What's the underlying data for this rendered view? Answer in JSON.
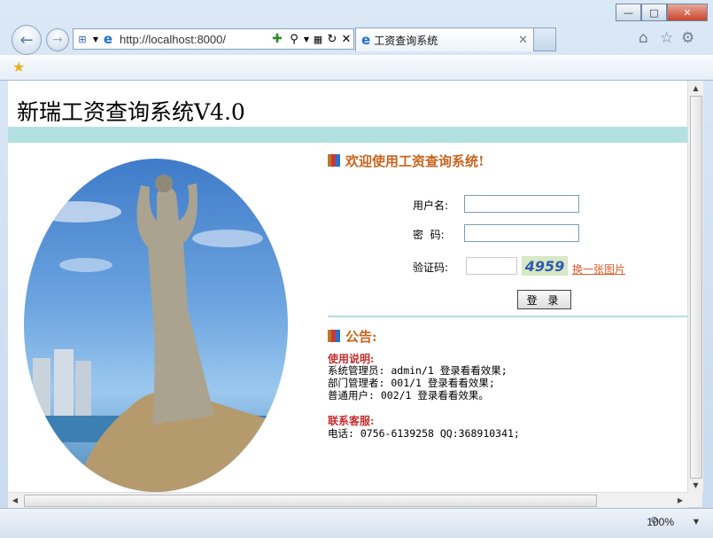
{
  "browser": {
    "url": "http://localhost:8000/",
    "tab_title": "工资查询系统",
    "zoom": "100%"
  },
  "page": {
    "title": "新瑞工资查询系统V4.0",
    "welcome": "欢迎使用工资查询系统!",
    "login": {
      "username_label": "用户名:",
      "password_label": "密  码:",
      "captcha_label": "验证码:",
      "captcha_code": "4959",
      "captcha_refresh": "换一张图片",
      "submit": "登 录"
    },
    "notice": {
      "title": "公告:",
      "usage_title": "使用说明:",
      "usage_lines": [
        "系统管理员: admin/1 登录看看效果;",
        "部门管理者: 001/1 登录看看效果;",
        "普通用户: 002/1 登录看看效果。"
      ],
      "contact_title": "联系客服:",
      "contact_line": "电话: 0756-6139258 QQ:368910341;"
    }
  }
}
